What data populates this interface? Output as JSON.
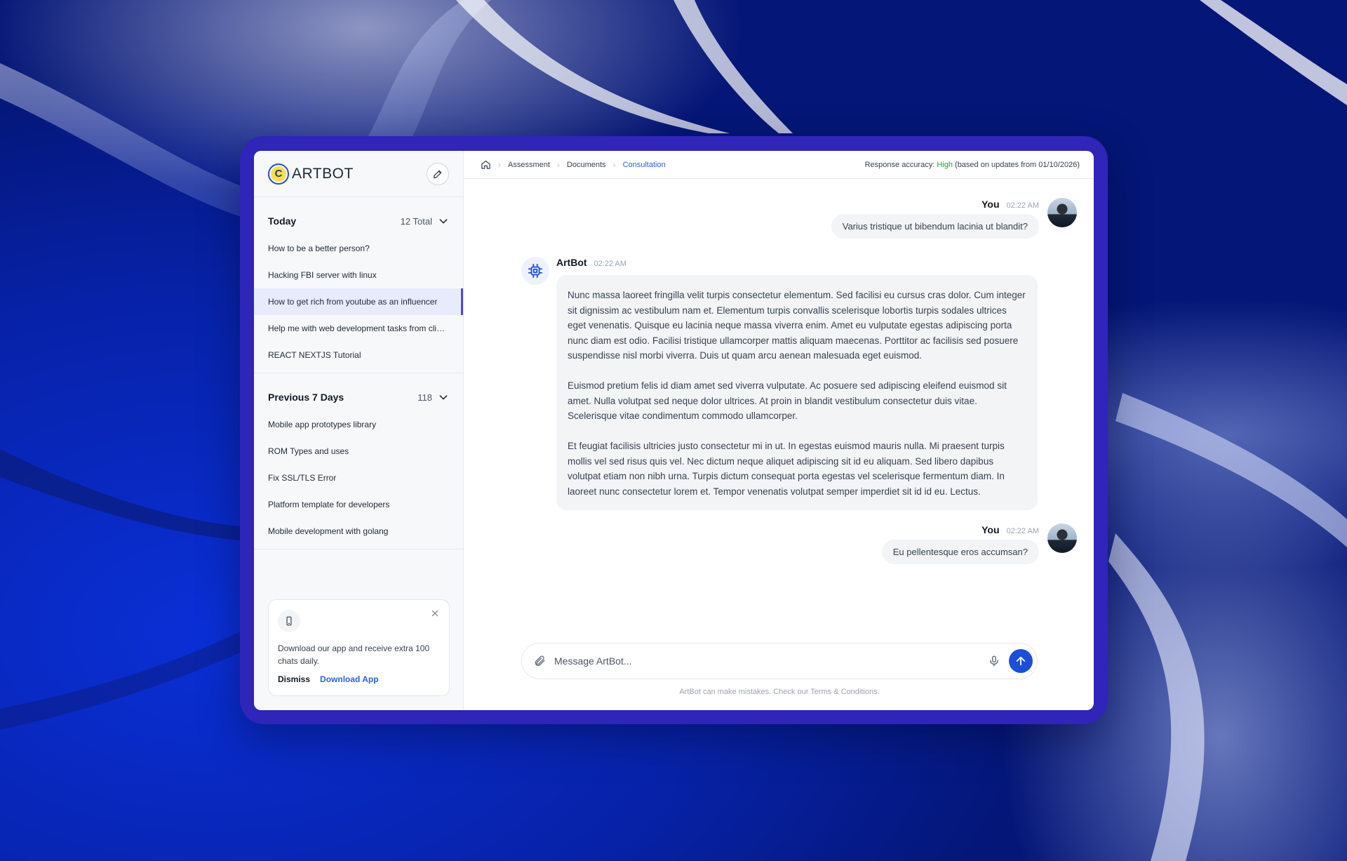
{
  "brand": {
    "name": "ARTBOT"
  },
  "sidebar": {
    "sections": [
      {
        "title": "Today",
        "meta": "12 Total",
        "items": [
          {
            "label": "How to be a better person?"
          },
          {
            "label": "Hacking FBI server with linux"
          },
          {
            "label": "How to get rich from youtube as an influencer",
            "active": true
          },
          {
            "label": "Help me with web development tasks from clients"
          },
          {
            "label": "REACT NEXTJS Tutorial"
          }
        ]
      },
      {
        "title": "Previous 7 Days",
        "meta": "118",
        "items": [
          {
            "label": "Mobile app prototypes library"
          },
          {
            "label": "ROM Types and uses"
          },
          {
            "label": "Fix SSL/TLS Error"
          },
          {
            "label": "Platform template for developers"
          },
          {
            "label": "Mobile development with golang"
          }
        ]
      }
    ],
    "promo": {
      "text": "Download our app and receive extra 100 chats daily.",
      "dismiss": "Dismiss",
      "download": "Download App"
    }
  },
  "topbar": {
    "breadcrumb": [
      "Assessment",
      "Documents",
      "Consultation"
    ],
    "accuracy_label": "Response accuracy:",
    "accuracy_value": "High",
    "accuracy_note": "(based on updates from 01/10/2026)"
  },
  "messages": [
    {
      "author": "You",
      "time": "02:22 AM",
      "text": "Varius tristique ut bibendum lacinia ut blandit?"
    },
    {
      "author": "ArtBot",
      "time": "02:22 AM",
      "paragraphs": [
        "Nunc massa laoreet fringilla velit turpis consectetur elementum. Sed facilisi eu cursus cras dolor. Cum integer sit dignissim ac vestibulum nam et. Elementum turpis convallis scelerisque lobortis turpis sodales ultrices eget venenatis. Quisque eu lacinia neque massa viverra enim. Amet eu vulputate egestas adipiscing porta nunc diam est odio. Facilisi tristique ullamcorper mattis aliquam maecenas. Porttitor ac facilisis sed posuere suspendisse nisl morbi viverra. Duis ut quam arcu aenean malesuada eget euismod.",
        "Euismod pretium felis id diam amet sed viverra vulputate. Ac posuere sed adipiscing eleifend euismod sit amet. Nulla volutpat sed neque dolor ultrices. At proin in blandit vestibulum consectetur duis vitae. Scelerisque vitae condimentum commodo ullamcorper.",
        "Et feugiat facilisis ultricies justo consectetur mi in ut. In egestas euismod mauris nulla. Mi praesent turpis mollis vel sed risus quis vel. Nec dictum neque aliquet adipiscing sit id eu aliquam. Sed libero dapibus volutpat etiam non nibh urna. Turpis dictum consequat porta egestas vel scelerisque fermentum diam. In laoreet nunc consectetur lorem et. Tempor venenatis volutpat semper imperdiet sit id id eu. Lectus."
      ]
    },
    {
      "author": "You",
      "time": "02:22 AM",
      "text": "Eu pellentesque eros accumsan?"
    }
  ],
  "composer": {
    "placeholder": "Message ArtBot...",
    "disclaimer": "ArtBot can make mistakes. Check our Terms & Conditions."
  },
  "colors": {
    "accent": "#1d4ed8",
    "frame": "#2f25b8",
    "high": "#16a34a"
  }
}
